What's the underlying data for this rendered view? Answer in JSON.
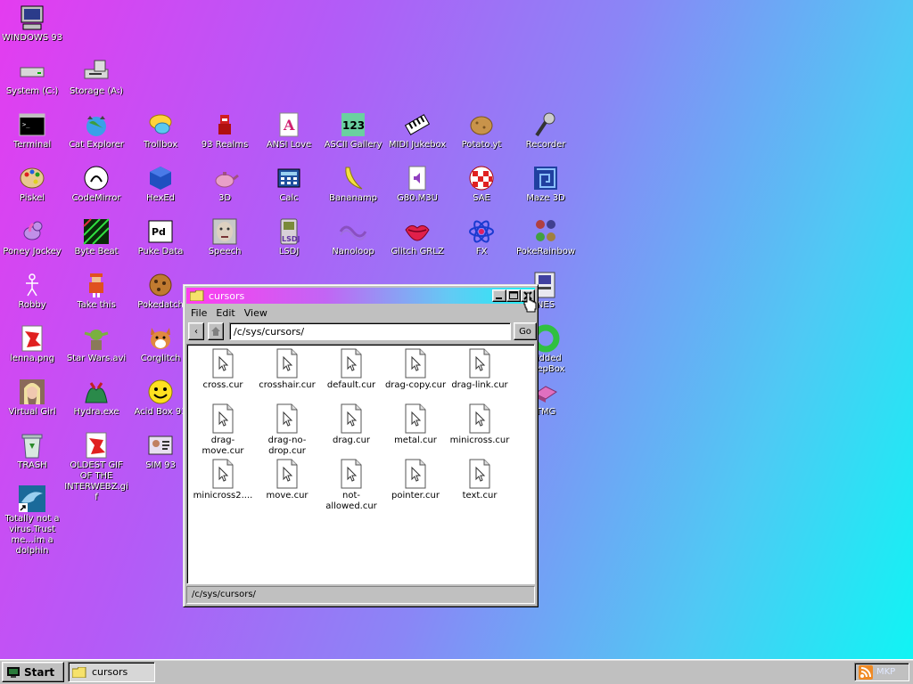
{
  "desktop": {
    "icons": [
      {
        "label": "WINDOWS 93",
        "icon": "computer-icon"
      },
      {
        "label": "System (C:)",
        "icon": "drive-icon"
      },
      {
        "label": "Storage (A:)",
        "icon": "floppy-drive-icon"
      },
      {
        "label": "Terminal",
        "icon": "terminal-icon"
      },
      {
        "label": "Cat Explorer",
        "icon": "cat-globe-icon"
      },
      {
        "label": "Trollbox",
        "icon": "chat-bubble-icon"
      },
      {
        "label": "93 Realms",
        "icon": "knight-icon"
      },
      {
        "label": "ANSI Love",
        "icon": "letter-a-icon"
      },
      {
        "label": "ASCII Gallery",
        "icon": "numbers-icon"
      },
      {
        "label": "MIDI Jukebox",
        "icon": "piano-icon"
      },
      {
        "label": "Potato.yt",
        "icon": "potato-icon"
      },
      {
        "label": "Recorder",
        "icon": "microphone-icon"
      },
      {
        "label": "Piskel",
        "icon": "palette-icon"
      },
      {
        "label": "CodeMirror",
        "icon": "codemirror-icon"
      },
      {
        "label": "HexEd",
        "icon": "cube-icon"
      },
      {
        "label": "3D",
        "icon": "teapot-icon"
      },
      {
        "label": "Calc",
        "icon": "calculator-icon"
      },
      {
        "label": "Bananamp",
        "icon": "banana-icon"
      },
      {
        "label": "G80.M3U",
        "icon": "audio-file-icon"
      },
      {
        "label": "SAE",
        "icon": "amiga-ball-icon"
      },
      {
        "label": "Maze 3D",
        "icon": "maze-icon"
      },
      {
        "label": "Poney Jockey",
        "icon": "pony-icon"
      },
      {
        "label": "Byte Beat",
        "icon": "bytebeat-icon"
      },
      {
        "label": "Puke Data",
        "icon": "pd-icon"
      },
      {
        "label": "Speech",
        "icon": "face-icon"
      },
      {
        "label": "LSDJ",
        "icon": "gameboy-icon"
      },
      {
        "label": "Nanoloop",
        "icon": "nanoloop-icon"
      },
      {
        "label": "Glitch GRLZ",
        "icon": "lips-icon"
      },
      {
        "label": "FX",
        "icon": "atom-icon"
      },
      {
        "label": "PokeRainbow",
        "icon": "trainers-icon"
      },
      {
        "label": "Robby",
        "icon": "stick-figure-icon"
      },
      {
        "label": "Take this",
        "icon": "pixel-man-icon"
      },
      {
        "label": "Pokedatch",
        "icon": "cookie-icon"
      },
      {
        "label": "NES",
        "icon": "nes-icon"
      },
      {
        "label": "lenna.png",
        "icon": "image-file-icon"
      },
      {
        "label": "Star Wars.avi",
        "icon": "yoda-icon"
      },
      {
        "label": "Corglitch",
        "icon": "corgi-icon"
      },
      {
        "label": "Hydra.exe",
        "icon": "hydra-icon"
      },
      {
        "label": "Acid Box 93",
        "icon": "smiley-icon"
      },
      {
        "label": "Virtual Girl",
        "icon": "girl-icon"
      },
      {
        "label": "TRASH",
        "icon": "recycle-bin-icon"
      },
      {
        "label": "OLDEST GIF OF THE INTERWEBZ.gif",
        "icon": "gif-file-icon"
      },
      {
        "label": "SIM 93",
        "icon": "sim-icon"
      },
      {
        "label": "Totally not a virus.Trust me...im a dolphin",
        "icon": "dolphin-shortcut-icon"
      },
      {
        "label": "Hidded PeepBox",
        "icon": "donut-icon"
      },
      {
        "label": "TMG",
        "icon": "tmg-icon"
      }
    ]
  },
  "window": {
    "title": "cursors",
    "menu": [
      "File",
      "Edit",
      "View"
    ],
    "address": "/c/sys/cursors/",
    "go_label": "Go",
    "back_label": "‹",
    "files": [
      "cross.cur",
      "crosshair.cur",
      "default.cur",
      "drag-copy.cur",
      "drag-link.cur",
      "drag-move.cur",
      "drag-no-drop.cur",
      "drag.cur",
      "metal.cur",
      "minicross.cur",
      "minicross2....",
      "move.cur",
      "not-allowed.cur",
      "pointer.cur",
      "text.cur"
    ],
    "status": "/c/sys/cursors/"
  },
  "taskbar": {
    "start_label": "Start",
    "task_label": "cursors",
    "tray_label": "MKP"
  },
  "colors": {
    "desktop_gradient": [
      "#e43cf0",
      "#b25cf7",
      "#4fc9f4",
      "#10f4f4"
    ],
    "window_face": "#c0c0c0"
  }
}
